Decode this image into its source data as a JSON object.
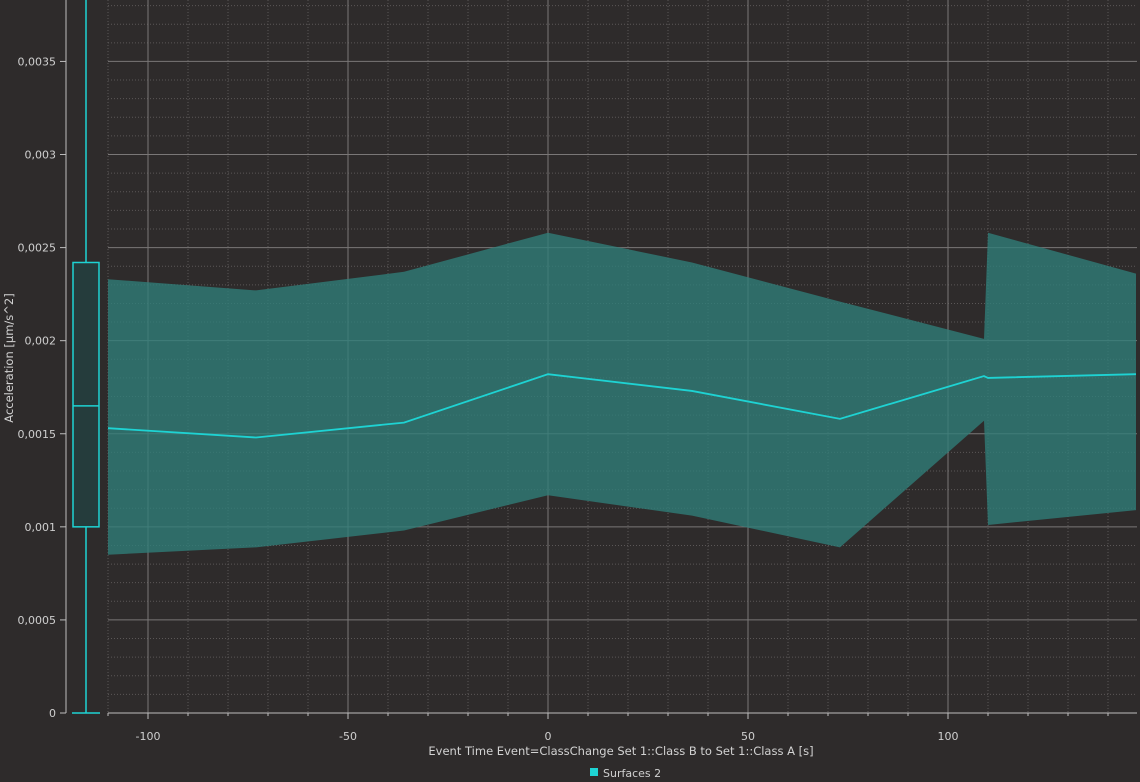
{
  "chart_data": {
    "type": "area",
    "xlabel": "Event Time Event=ClassChange Set 1::Class B to Set 1::Class A [s]",
    "ylabel": "Acceleration [µm/s^2]",
    "xlim": [
      -110,
      147
    ],
    "ylim": [
      0,
      0.00383
    ],
    "x_ticks": [
      -100,
      -50,
      0,
      50,
      100
    ],
    "x_tick_labels": [
      "-100",
      "-50",
      "0",
      "50",
      "100"
    ],
    "y_ticks": [
      0,
      0.0005,
      0.001,
      0.0015,
      0.002,
      0.0025,
      0.003,
      0.0035
    ],
    "y_tick_labels": [
      "0",
      "0,0005",
      "0,001",
      "0,0015",
      "0,002",
      "0,0025",
      "0,003",
      "0,0035"
    ],
    "grid": true,
    "minor_grid": true,
    "legend_position": "bottom-center",
    "series": [
      {
        "name": "Surfaces 2",
        "color": "#1ed3d3",
        "band_color": "#2f7f7a",
        "x": [
          -110,
          -73,
          -36,
          0,
          36,
          73,
          109,
          110,
          147
        ],
        "mean": [
          0.00153,
          0.00148,
          0.00156,
          0.00182,
          0.00173,
          0.00158,
          0.00181,
          0.0018,
          0.00182
        ],
        "upper": [
          0.00233,
          0.00227,
          0.00237,
          0.00258,
          0.00242,
          0.00221,
          0.00201,
          0.00258,
          0.00236
        ],
        "lower": [
          0.00085,
          0.00089,
          0.00098,
          0.00117,
          0.00106,
          0.00089,
          0.00157,
          0.00101,
          0.00109
        ]
      }
    ],
    "boxplot": {
      "min": 0,
      "q1": 0.001,
      "median": 0.00165,
      "q3": 0.00242,
      "max": 0.00383
    }
  },
  "legend": {
    "label": "Surfaces 2",
    "swatch_color": "#1ed3d3"
  }
}
